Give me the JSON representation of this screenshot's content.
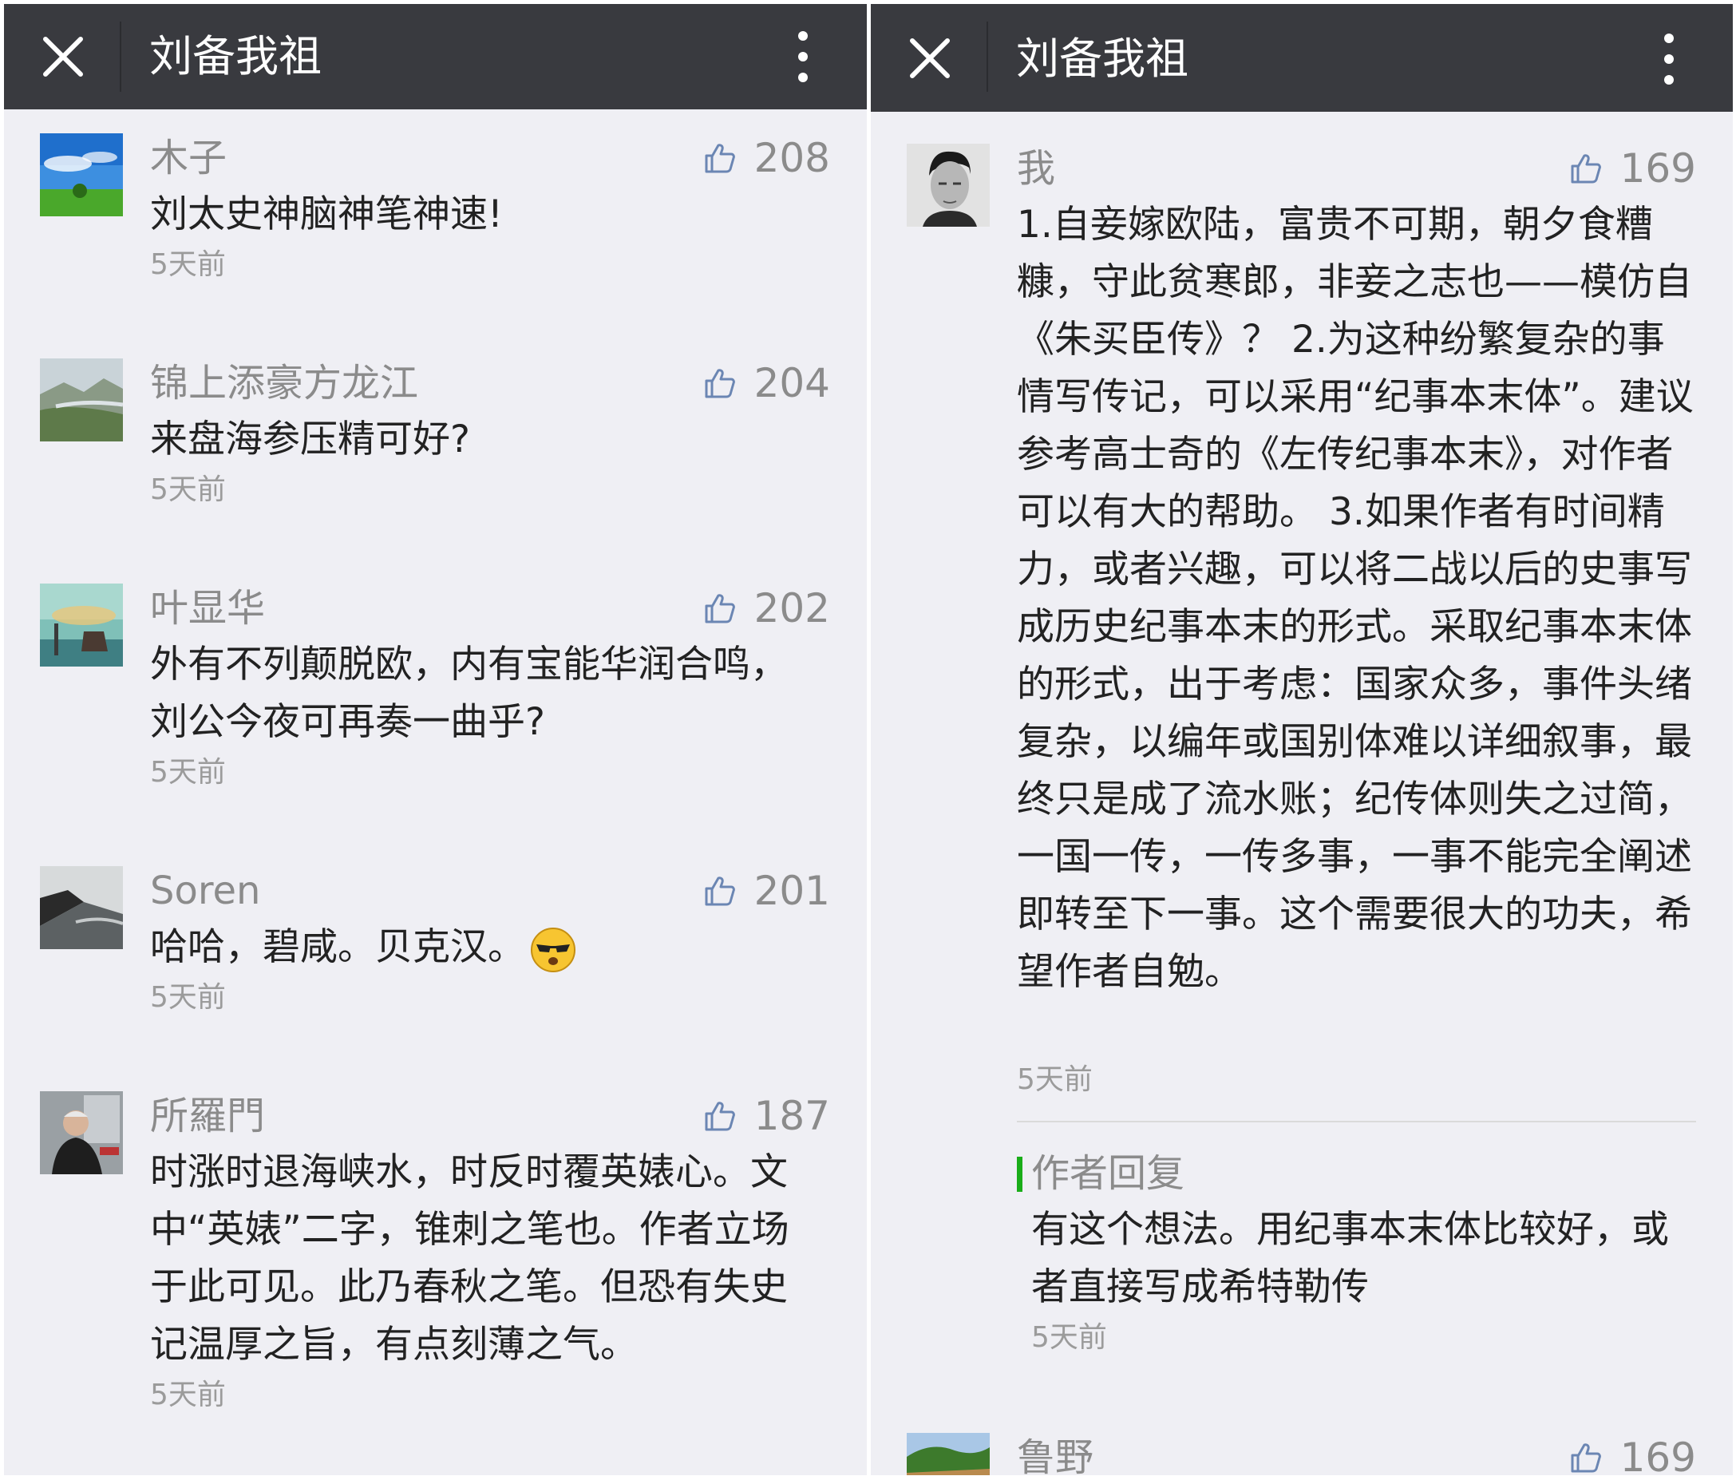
{
  "left": {
    "title": "刘备我祖",
    "comments": [
      {
        "name": "木子",
        "likes": "208",
        "text": "刘太史神脑神笔神速!",
        "time": "5天前"
      },
      {
        "name": "锦上添豪方龙江",
        "likes": "204",
        "text": "来盘海参压精可好?",
        "time": "5天前"
      },
      {
        "name": "叶显华",
        "likes": "202",
        "text": "外有不列颠脱欧，内有宝能华润合鸣，刘公今夜可再奏一曲乎?",
        "time": "5天前"
      },
      {
        "name": "Soren",
        "likes": "201",
        "text": "哈哈，碧咸。贝克汉。",
        "time": "5天前"
      },
      {
        "name": "所羅門",
        "likes": "187",
        "text": "时涨时退海峡水，时反时覆英婊心。文中“英婊”二字，锥刺之笔也。作者立场于此可见。此乃春秋之笔。但恐有失史记温厚之旨，有点刻薄之气。",
        "time": "5天前"
      }
    ]
  },
  "right": {
    "title": "刘备我祖",
    "comments": [
      {
        "name": "我",
        "likes": "169",
        "text": "1.自妾嫁欧陆，富贵不可期，朝夕食糟糠，守此贫寒郎，非妾之志也——模仿自《朱买臣传》？ 2.为这种纷繁复杂的事情写传记，可以采用“纪事本末体”。建议参考高士奇的《左传纪事本末》，对作者可以有大的帮助。 3.如果作者有时间精力，或者兴趣，可以将二战以后的史事写成历史纪事本末的形式。采取纪事本末体的形式，出于考虑：国家众多，事件头绪复杂，以编年或国别体难以详细叙事，最终只是成了流水账；纪传体则失之过简，一国一传，一传多事，一事不能完全阐述即转至下一事。这个需要很大的功夫，希望作者自勉。",
        "time": "5天前"
      },
      {
        "name": "鲁野",
        "likes": "169"
      }
    ],
    "reply": {
      "label": "作者回复",
      "text": "有这个想法。用纪事本末体比较好，或者直接写成希特勒传",
      "time": "5天前"
    }
  },
  "icons": {
    "close": "close-icon",
    "more": "more-vertical-icon",
    "like": "thumbs-up-icon",
    "emoji": "sunglasses-emoji-icon"
  },
  "colors": {
    "topbar": "#393a3f",
    "background": "#efeff4",
    "reply_accent": "#1aad19",
    "secondary_text": "#8b8b8b"
  }
}
